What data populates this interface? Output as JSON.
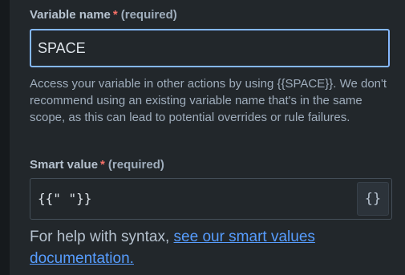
{
  "variable_name": {
    "label": "Variable name",
    "required_marker": "*",
    "required_text": "(required)",
    "value": "SPACE",
    "help_text": "Access your variable in other actions by using {{SPACE}}. We don't recommend using an existing variable name that's in the same scope, as this can lead to potential overrides or rule failures."
  },
  "smart_value": {
    "label": "Smart value",
    "required_marker": "*",
    "required_text": "(required)",
    "value": "{{\" \"}}",
    "insert_button_icon": "curly-braces-icon",
    "insert_button_glyph": "{}"
  },
  "syntax_help": {
    "prefix": "For help with syntax,",
    "link_text": "see our smart values documentation."
  },
  "colors": {
    "background": "#22272b",
    "focus_border": "#85b8ff",
    "required_star": "#f87168",
    "link": "#579dff"
  }
}
